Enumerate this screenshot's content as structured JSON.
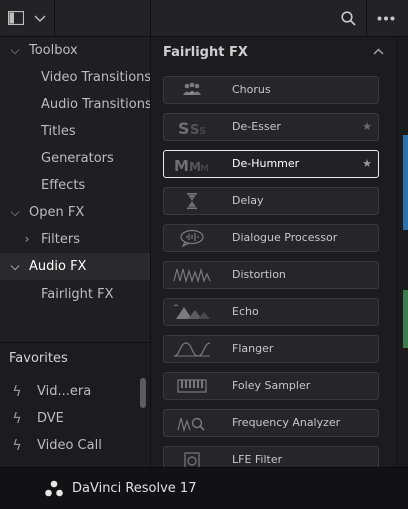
{
  "app": {
    "name": "DaVinci Resolve 17",
    "logo_icon": "davinci-resolve-logo-icon"
  },
  "toolbar": {
    "panel_toggle_icon": "panel-toggle-icon",
    "dropdown_icon": "chevron-down-icon",
    "search_icon": "search-icon",
    "more_icon": "ellipsis-icon"
  },
  "sidebar": {
    "items": [
      {
        "label": "Toolbox",
        "level": 0,
        "expanded": true,
        "selected": false
      },
      {
        "label": "Video Transitions",
        "level": 1,
        "selected": false
      },
      {
        "label": "Audio Transitions",
        "level": 1,
        "selected": false
      },
      {
        "label": "Titles",
        "level": 1,
        "selected": false
      },
      {
        "label": "Generators",
        "level": 1,
        "selected": false
      },
      {
        "label": "Effects",
        "level": 1,
        "selected": false
      },
      {
        "label": "Open FX",
        "level": 0,
        "expanded": true,
        "selected": false
      },
      {
        "label": "Filters",
        "level": 1,
        "expandable": true,
        "expanded": false,
        "selected": false
      },
      {
        "label": "Audio FX",
        "level": 0,
        "expanded": true,
        "selected": true
      },
      {
        "label": "Fairlight FX",
        "level": 1,
        "selected": false
      }
    ]
  },
  "favorites": {
    "title": "Favorites",
    "items": [
      {
        "label": "Vid...era",
        "icon": "bolt-icon"
      },
      {
        "label": "DVE",
        "icon": "bolt-icon"
      },
      {
        "label": "Video Call",
        "icon": "bolt-icon"
      }
    ]
  },
  "main": {
    "section_title": "Fairlight FX",
    "collapse_icon": "chevron-up-icon",
    "effects": [
      {
        "label": "Chorus",
        "icon": "chorus-icon",
        "selected": false,
        "star": false
      },
      {
        "label": "De-Esser",
        "icon": "de-esser-icon",
        "selected": false,
        "star": true
      },
      {
        "label": "De-Hummer",
        "icon": "de-hummer-icon",
        "selected": true,
        "star": true
      },
      {
        "label": "Delay",
        "icon": "hourglass-icon",
        "selected": false,
        "star": false
      },
      {
        "label": "Dialogue Processor",
        "icon": "speech-bubble-icon",
        "selected": false,
        "star": false
      },
      {
        "label": "Distortion",
        "icon": "distortion-wave-icon",
        "selected": false,
        "star": false
      },
      {
        "label": "Echo",
        "icon": "echo-mountains-icon",
        "selected": false,
        "star": false
      },
      {
        "label": "Flanger",
        "icon": "flanger-wave-icon",
        "selected": false,
        "star": false
      },
      {
        "label": "Foley Sampler",
        "icon": "piano-keys-icon",
        "selected": false,
        "star": false
      },
      {
        "label": "Frequency Analyzer",
        "icon": "frequency-analyzer-icon",
        "selected": false,
        "star": false
      },
      {
        "label": "LFE Filter",
        "icon": "speaker-icon",
        "selected": false,
        "star": false
      }
    ]
  },
  "colors": {
    "background": "#1c1c1f",
    "selected_border": "#e8e8e8",
    "right_strip_blue": "#2f6fa8",
    "right_strip_green": "#3f7a4a"
  }
}
